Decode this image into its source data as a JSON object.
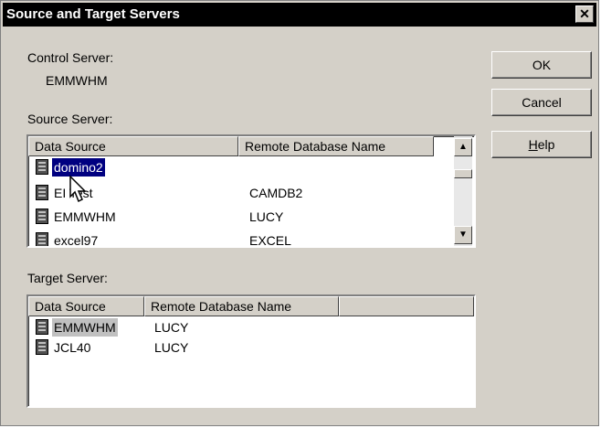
{
  "dialog": {
    "title": "Source and Target Servers",
    "close_glyph": "✕"
  },
  "control_server": {
    "label": "Control Server:",
    "value": "EMMWHM"
  },
  "source_server": {
    "label": "Source Server:",
    "columns": [
      "Data Source",
      "Remote Database Name"
    ],
    "rows": [
      {
        "data_source": "domino2",
        "remote_db": ""
      },
      {
        "data_source": "EI Test",
        "remote_db": "CAMDB2"
      },
      {
        "data_source": "EMMWHM",
        "remote_db": "LUCY"
      },
      {
        "data_source": "excel97",
        "remote_db": "EXCEL"
      }
    ],
    "selected_index": 0
  },
  "target_server": {
    "label": "Target Server:",
    "columns": [
      "Data Source",
      "Remote Database Name"
    ],
    "rows": [
      {
        "data_source": "EMMWHM",
        "remote_db": "LUCY"
      },
      {
        "data_source": "JCL40",
        "remote_db": "LUCY"
      }
    ],
    "selected_index": 0
  },
  "buttons": {
    "ok": "OK",
    "cancel": "Cancel",
    "help_mnemonic": "H",
    "help_rest": "elp"
  },
  "icons": {
    "row_icon": "database-icon",
    "scroll_up": "▲",
    "scroll_down": "▼"
  }
}
